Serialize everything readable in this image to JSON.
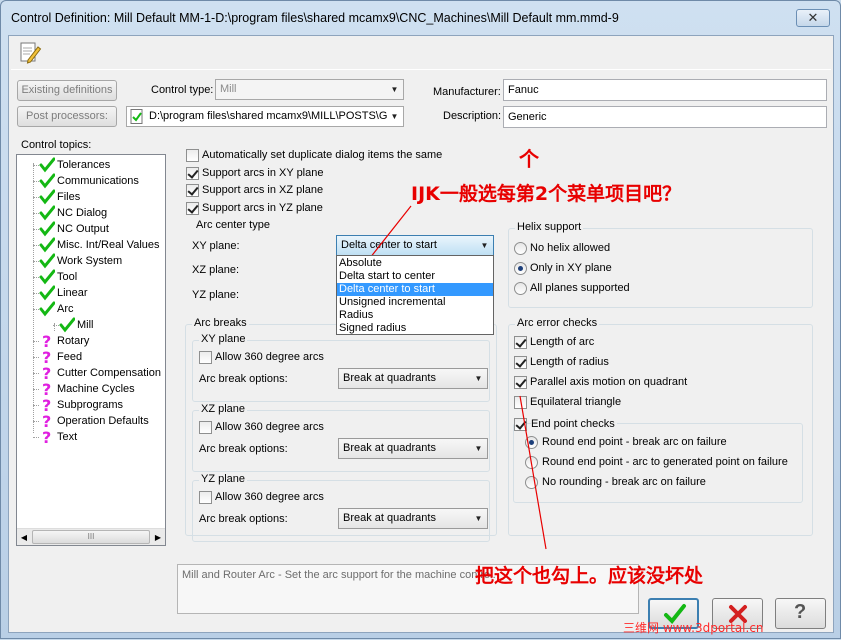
{
  "window": {
    "title": "Control Definition: Mill Default MM-1-D:\\program files\\shared mcamx9\\CNC_Machines\\Mill Default mm.mmd-9",
    "close_glyph": "✕"
  },
  "top": {
    "existing_definitions": "Existing definitions",
    "post_processors": "Post processors:",
    "control_type_label": "Control type:",
    "control_type_value": "Mill",
    "post_path": "D:\\program files\\shared mcamx9\\MILL\\POSTS\\G",
    "manufacturer_label": "Manufacturer:",
    "manufacturer_value": "Fanuc",
    "description_label": "Description:",
    "description_value": "Generic"
  },
  "tree": {
    "label": "Control topics:",
    "items": [
      {
        "label": "Tolerances",
        "icon": "check"
      },
      {
        "label": "Communications",
        "icon": "check"
      },
      {
        "label": "Files",
        "icon": "check"
      },
      {
        "label": "NC Dialog",
        "icon": "check"
      },
      {
        "label": "NC Output",
        "icon": "check"
      },
      {
        "label": "Misc. Int/Real Values",
        "icon": "check"
      },
      {
        "label": "Work System",
        "icon": "check"
      },
      {
        "label": "Tool",
        "icon": "check"
      },
      {
        "label": "Linear",
        "icon": "check"
      },
      {
        "label": "Arc",
        "icon": "check"
      },
      {
        "label": "Mill",
        "icon": "check"
      },
      {
        "label": "Rotary",
        "icon": "question"
      },
      {
        "label": "Feed",
        "icon": "question"
      },
      {
        "label": "Cutter Compensation",
        "icon": "question"
      },
      {
        "label": "Machine Cycles",
        "icon": "question"
      },
      {
        "label": "Subprograms",
        "icon": "question"
      },
      {
        "label": "Operation Defaults",
        "icon": "question"
      },
      {
        "label": "Text",
        "icon": "question"
      }
    ],
    "scroll_grip": "III"
  },
  "options": {
    "auto_duplicate": {
      "label": "Automatically set duplicate dialog items the same",
      "checked": false
    },
    "support_xy": {
      "label": "Support arcs in XY plane",
      "checked": true
    },
    "support_xz": {
      "label": "Support arcs in XZ plane",
      "checked": true
    },
    "support_yz": {
      "label": "Support arcs in YZ plane",
      "checked": true
    }
  },
  "arc_center": {
    "title": "Arc center type",
    "xy_label": "XY plane:",
    "xz_label": "XZ plane:",
    "yz_label": "YZ plane:",
    "xy_value": "Delta center to start",
    "dropdown_options": [
      "Absolute",
      "Delta start to center",
      "Delta center to start",
      "Unsigned incremental",
      "Radius",
      "Signed radius"
    ],
    "highlighted": "Delta center to start"
  },
  "arc_breaks": {
    "title": "Arc breaks",
    "planes": [
      {
        "title": "XY plane",
        "allow_label": "Allow 360 degree arcs",
        "checked": false,
        "options_label": "Arc break options:",
        "value": "Break at quadrants"
      },
      {
        "title": "XZ plane",
        "allow_label": "Allow 360 degree arcs",
        "checked": false,
        "options_label": "Arc break options:",
        "value": "Break at quadrants"
      },
      {
        "title": "YZ plane",
        "allow_label": "Allow 360 degree arcs",
        "checked": false,
        "options_label": "Arc break options:",
        "value": "Break at quadrants"
      }
    ]
  },
  "helix": {
    "title": "Helix support",
    "options": [
      {
        "label": "No helix allowed",
        "selected": false
      },
      {
        "label": "Only in XY plane",
        "selected": true
      },
      {
        "label": "All planes supported",
        "selected": false
      }
    ]
  },
  "arc_error": {
    "title": "Arc error checks",
    "checks": [
      {
        "label": "Length of arc",
        "checked": true
      },
      {
        "label": "Length of radius",
        "checked": true
      },
      {
        "label": "Parallel axis motion on quadrant",
        "checked": true
      },
      {
        "label": "Equilateral triangle",
        "checked": false
      }
    ],
    "end_point": {
      "label": "End point checks",
      "checked": true
    },
    "end_point_options": [
      {
        "label": "Round end point - break arc on failure",
        "selected": true
      },
      {
        "label": "Round end point - arc to generated point on failure",
        "selected": false
      },
      {
        "label": "No rounding - break arc on failure",
        "selected": false
      }
    ]
  },
  "description_box": "Mill and Router Arc - Set the arc support for the machine control.",
  "buttons": {
    "ok": "OK",
    "cancel": "Cancel",
    "help": "?"
  },
  "annotations": {
    "arrow_glyph": "个",
    "top_note": "IJK一般选每第2个菜单项目吧？",
    "bottom_note": "把这个也勾上。应该没坏处",
    "watermark": "三维网 www.3dportal.cn"
  },
  "colors": {
    "annotation_red": "#e80000",
    "check_green": "#14b814",
    "question_magenta": "#e020e0",
    "highlight_blue": "#3399ff"
  }
}
